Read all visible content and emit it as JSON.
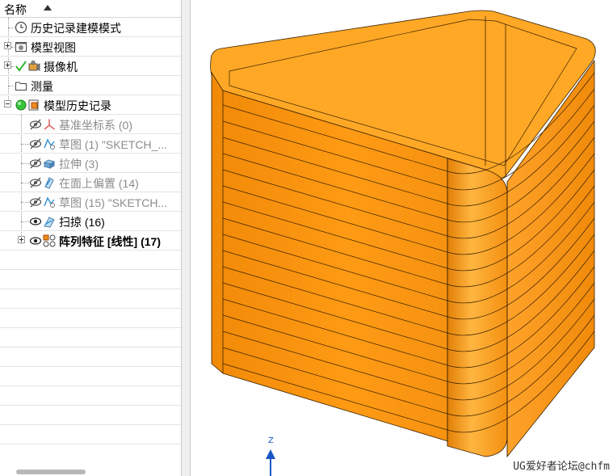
{
  "navigator": {
    "header_title": "名称",
    "items": [
      {
        "label": "历史记录建模模式",
        "icon": "clock-icon",
        "state": "normal"
      },
      {
        "label": "模型视图",
        "icon": "model-view-icon",
        "state": "normal"
      },
      {
        "label": "摄像机",
        "icon": "camera-icon",
        "state": "normal"
      },
      {
        "label": "测量",
        "icon": "folder-icon",
        "state": "normal"
      },
      {
        "label": "模型历史记录",
        "icon": "model-history-icon",
        "state": "normal"
      },
      {
        "label": "基准坐标系 (0)",
        "icon": "datum-csys-icon",
        "state": "suppressed"
      },
      {
        "label": "草图 (1) \"SKETCH_...",
        "icon": "sketch-icon",
        "state": "suppressed"
      },
      {
        "label": "拉伸 (3)",
        "icon": "extrude-icon",
        "state": "suppressed"
      },
      {
        "label": "在面上偏置 (14)",
        "icon": "offset-icon",
        "state": "suppressed"
      },
      {
        "label": "草图 (15) \"SKETCH...",
        "icon": "sketch-icon",
        "state": "suppressed"
      },
      {
        "label": "扫掠 (16)",
        "icon": "sweep-icon",
        "state": "visible"
      },
      {
        "label": "阵列特征 [线性] (17)",
        "icon": "pattern-icon",
        "state": "visible-bold"
      }
    ]
  },
  "viewport": {
    "axis_label": "Z",
    "watermark": "UG爱好者论坛@chfm",
    "model_color": "#ff9a0f",
    "edge_color": "#3b2200"
  },
  "colors": {
    "accent_check": "#2eb82e",
    "axis_blue": "#1a56c4"
  }
}
